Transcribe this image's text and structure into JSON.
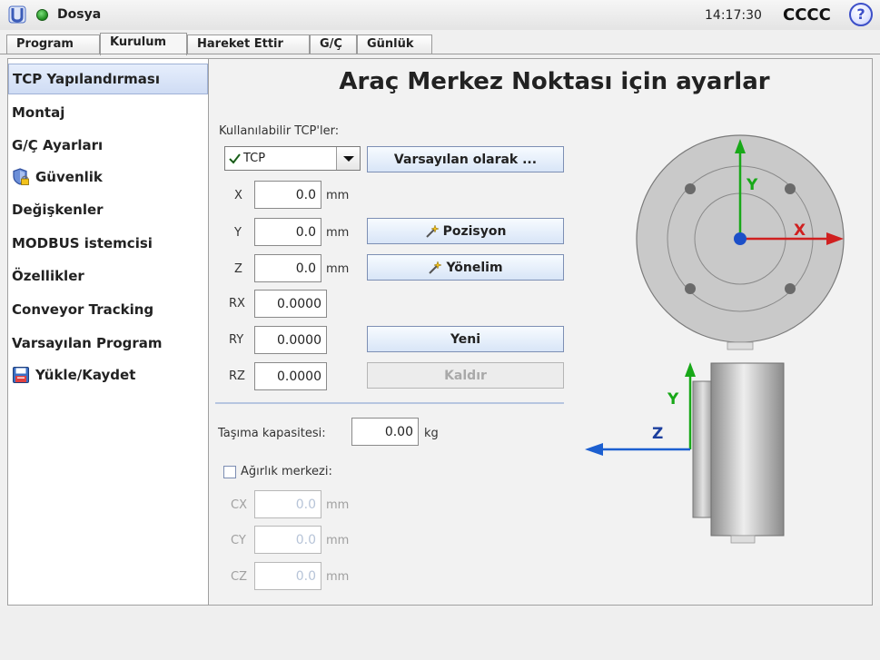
{
  "topbar": {
    "file_menu": "Dosya",
    "clock": "14:17:30",
    "robot_name": "CCCC",
    "help": "?"
  },
  "tabs": [
    {
      "label": "Program"
    },
    {
      "label": "Kurulum"
    },
    {
      "label": "Hareket Ettir"
    },
    {
      "label": "G/Ç"
    },
    {
      "label": "Günlük"
    }
  ],
  "sidebar": {
    "items": [
      {
        "label": "TCP Yapılandırması"
      },
      {
        "label": "Montaj"
      },
      {
        "label": "G/Ç Ayarları"
      },
      {
        "label": "Güvenlik",
        "icon": "shield-lock-icon"
      },
      {
        "label": "Değişkenler"
      },
      {
        "label": "MODBUS istemcisi"
      },
      {
        "label": "Özellikler"
      },
      {
        "label": "Conveyor Tracking"
      },
      {
        "label": "Varsayılan Program"
      },
      {
        "label": "Yükle/Kaydet",
        "icon": "floppy-disk-icon"
      }
    ]
  },
  "main": {
    "title": "Araç Merkez Noktası için ayarlar",
    "available_tcps_label": "Kullanılabilir TCP'ler:",
    "tcp_select_value": "TCP",
    "set_default_button": "Varsayılan olarak ...",
    "fields": {
      "x": {
        "label": "X",
        "value": "0.0",
        "unit": "mm"
      },
      "y": {
        "label": "Y",
        "value": "0.0",
        "unit": "mm"
      },
      "z": {
        "label": "Z",
        "value": "0.0",
        "unit": "mm"
      },
      "rx": {
        "label": "RX",
        "value": "0.0000"
      },
      "ry": {
        "label": "RY",
        "value": "0.0000"
      },
      "rz": {
        "label": "RZ",
        "value": "0.0000"
      }
    },
    "position_button": "Pozisyon",
    "orientation_button": "Yönelim",
    "new_button": "Yeni",
    "remove_button": "Kaldır",
    "payload": {
      "label": "Taşıma kapasitesi:",
      "value": "0.00",
      "unit": "kg"
    },
    "center_of_gravity_label": "Ağırlık merkezi:",
    "center_of_gravity_checked": false,
    "cog": {
      "cx": {
        "label": "CX",
        "value": "0.0",
        "unit": "mm"
      },
      "cy": {
        "label": "CY",
        "value": "0.0",
        "unit": "mm"
      },
      "cz": {
        "label": "CZ",
        "value": "0.0",
        "unit": "mm"
      }
    },
    "diagram": {
      "front_axes": {
        "x": "X",
        "y": "Y"
      },
      "side_axes": {
        "y": "Y",
        "z": "Z"
      },
      "colors": {
        "x_axis": "#d02020",
        "y_axis": "#18a818",
        "z_axis": "#1c5fd0"
      }
    }
  }
}
